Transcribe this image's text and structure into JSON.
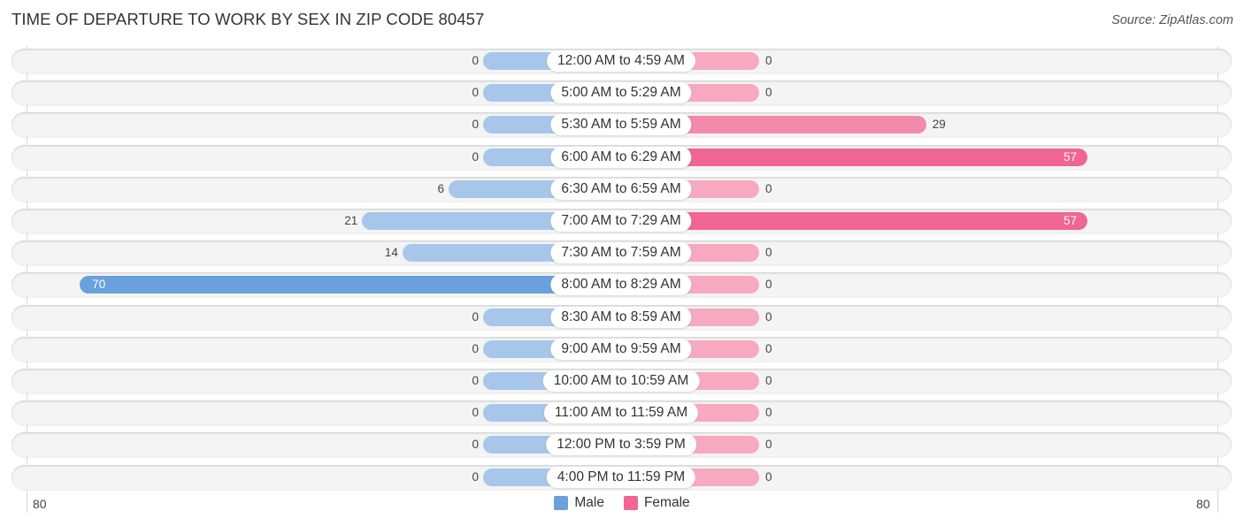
{
  "chart_data": {
    "type": "bar",
    "orientation": "horizontal-diverging",
    "title": "TIME OF DEPARTURE TO WORK BY SEX IN ZIP CODE 80457",
    "source": "Source: ZipAtlas.com",
    "categories": [
      "12:00 AM to 4:59 AM",
      "5:00 AM to 5:29 AM",
      "5:30 AM to 5:59 AM",
      "6:00 AM to 6:29 AM",
      "6:30 AM to 6:59 AM",
      "7:00 AM to 7:29 AM",
      "7:30 AM to 7:59 AM",
      "8:00 AM to 8:29 AM",
      "8:30 AM to 8:59 AM",
      "9:00 AM to 9:59 AM",
      "10:00 AM to 10:59 AM",
      "11:00 AM to 11:59 AM",
      "12:00 PM to 3:59 PM",
      "4:00 PM to 11:59 PM"
    ],
    "series": [
      {
        "name": "Male",
        "color": "#6aa0dc",
        "values": [
          0,
          0,
          0,
          0,
          6,
          21,
          14,
          70,
          0,
          0,
          0,
          0,
          0,
          0
        ]
      },
      {
        "name": "Female",
        "color": "#f06593",
        "values": [
          0,
          0,
          29,
          57,
          0,
          57,
          0,
          0,
          0,
          0,
          0,
          0,
          0,
          0
        ]
      }
    ],
    "xlim": [
      80,
      80
    ],
    "axis_tick_labels": {
      "left": "80",
      "right": "80"
    },
    "legend": {
      "placement": "bottom-center",
      "entries": [
        "Male",
        "Female"
      ]
    },
    "grid": false
  }
}
